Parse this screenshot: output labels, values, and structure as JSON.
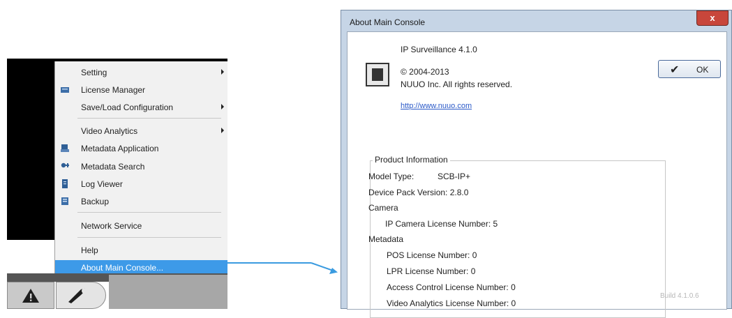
{
  "menu": {
    "items": [
      {
        "label": "Setting",
        "icon": "",
        "submenu": true
      },
      {
        "label": "License Manager",
        "icon": "license-icon",
        "submenu": false
      },
      {
        "label": "Save/Load Configuration",
        "icon": "",
        "submenu": true
      },
      {
        "label": "Video Analytics",
        "icon": "",
        "submenu": true
      },
      {
        "label": "Metadata Application",
        "icon": "metadata-application-icon",
        "submenu": false
      },
      {
        "label": "Metadata Search",
        "icon": "metadata-search-icon",
        "submenu": false
      },
      {
        "label": "Log Viewer",
        "icon": "log-viewer-icon",
        "submenu": false
      },
      {
        "label": "Backup",
        "icon": "backup-icon",
        "submenu": false
      },
      {
        "label": "Network Service",
        "icon": "",
        "submenu": false
      },
      {
        "label": "Help",
        "icon": "",
        "submenu": false
      },
      {
        "label": "About Main Console...",
        "icon": "",
        "submenu": false
      }
    ],
    "highlight_color": "#3d9ae8"
  },
  "toolbar": {
    "warning_glyph": "⚠",
    "tools_glyph": "🔧"
  },
  "dialog": {
    "title": "About Main Console",
    "close_label": "x",
    "product_name": "IP Surveillance 4.1.0",
    "copyright": "© 2004-2013",
    "rights": "NUUO Inc. All rights reserved.",
    "link": "http://www.nuuo.com",
    "ok_label": "OK",
    "group_title": "Product Information",
    "info": {
      "model_type_label": "Model Type:",
      "model_type_value": "SCB-IP+",
      "device_pack": "Device Pack Version:  2.8.0",
      "camera_heading": "Camera",
      "ip_camera_license": "IP Camera License Number: 5",
      "metadata_heading": "Metadata",
      "pos_license": "POS License Number: 0",
      "lpr_license": "LPR License Number: 0",
      "access_control_license": "Access Control License Number: 0",
      "video_analytics_license": "Video Analytics License Number: 0"
    },
    "build": "Build 4.1.0.6"
  },
  "colors": {
    "arrow": "#3a9be0",
    "link": "#2a59c8"
  }
}
